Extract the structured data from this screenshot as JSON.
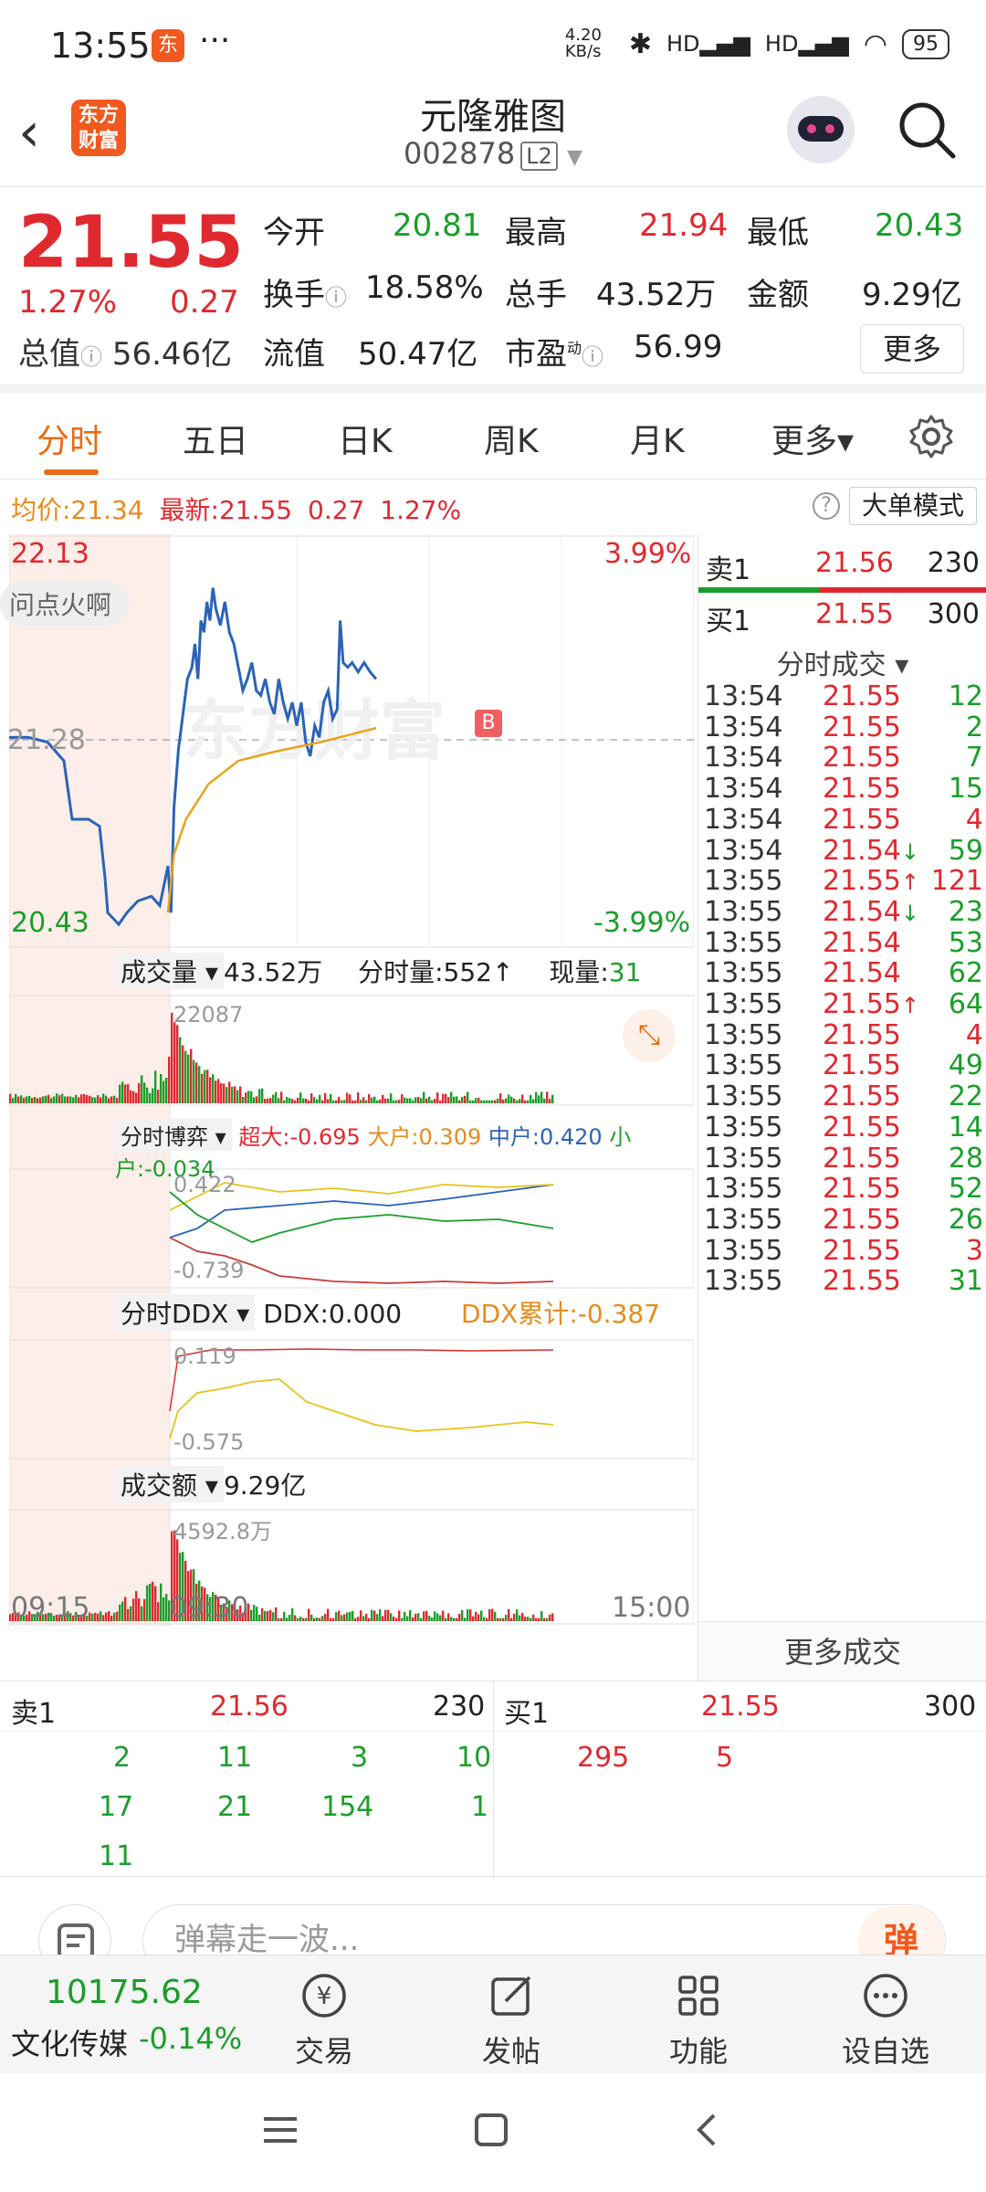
{
  "status_bar": {
    "time": "13:55",
    "app_icon": "东",
    "dots": "···",
    "net_speed": "4.20 KB/s",
    "signal1": "HD",
    "signal2": "HD",
    "battery": "95"
  },
  "header": {
    "back_icon": "chevron-left-icon",
    "logo_line1": "东方",
    "logo_line2": "财富",
    "stock_name": "元隆雅图",
    "stock_code": "002878",
    "level": "L2"
  },
  "quote": {
    "price": "21.55",
    "change_pct": "1.27%",
    "change": "0.27",
    "open_label": "今开",
    "open": "20.81",
    "high_label": "最高",
    "high": "21.94",
    "low_label": "最低",
    "low": "20.43",
    "turnover_label": "换手",
    "turnover": "18.58%",
    "volume_label": "总手",
    "volume": "43.52万",
    "amount_label": "金额",
    "amount": "9.29亿",
    "mktcap_label": "总值",
    "mktcap": "56.46亿",
    "float_label": "流值",
    "float": "50.47亿",
    "pe_label": "市盈",
    "pe_sup": "动",
    "pe": "56.99",
    "more": "更多"
  },
  "tabs": [
    {
      "label": "分时",
      "active": true
    },
    {
      "label": "五日"
    },
    {
      "label": "日K"
    },
    {
      "label": "周K"
    },
    {
      "label": "月K"
    },
    {
      "label": "更多▾"
    }
  ],
  "info_line": {
    "avg_label": "均价:",
    "avg": "21.34",
    "latest_label": "最新:",
    "latest": "21.55",
    "chg": "0.27",
    "pct": "1.27%",
    "help": "?",
    "big_order_mode": "大单模式"
  },
  "chart": {
    "high_price": "22.13",
    "low_price": "20.43",
    "ref_price": "21.28",
    "up_pct": "3.99%",
    "down_pct": "-3.99%",
    "overlay_text": "问点火啊",
    "marker": "B",
    "volume_panel": {
      "dropdown": "成交量",
      "total": "43.52万",
      "tick_label": "分时量:",
      "tick": "552",
      "tick_arrow": "↑",
      "now_label": "现量:",
      "now": "31",
      "max": "22087"
    },
    "game_panel": {
      "dropdown": "分时博弈",
      "super_label": "超大:",
      "super": "-0.695",
      "big_label": "大户:",
      "big": "0.309",
      "mid_label": "中户:",
      "mid": "0.420",
      "small_label": "小户:",
      "small": "-0.034",
      "top": "0.422",
      "bottom": "-0.739"
    },
    "ddx_panel": {
      "dropdown": "分时DDX",
      "ddx_label": "DDX:",
      "ddx": "0.000",
      "cum_label": "DDX累计:",
      "cum": "-0.387",
      "top": "0.119",
      "bottom": "-0.575"
    },
    "amount_panel": {
      "dropdown": "成交额",
      "total": "9.29亿",
      "max": "4592.8万"
    },
    "time_axis": [
      "09:15",
      "09:30",
      "15:00"
    ]
  },
  "order_book": {
    "sell1_label": "卖1",
    "sell1_price": "21.56",
    "sell1_vol": "230",
    "buy1_label": "买1",
    "buy1_price": "21.55",
    "buy1_vol": "300"
  },
  "trades_header": "分时成交 ▾",
  "trades": [
    {
      "time": "13:54",
      "price": "21.55",
      "arrow": "",
      "vol": "12",
      "dir": "g"
    },
    {
      "time": "13:54",
      "price": "21.55",
      "arrow": "",
      "vol": "2",
      "dir": "g"
    },
    {
      "time": "13:54",
      "price": "21.55",
      "arrow": "",
      "vol": "7",
      "dir": "g"
    },
    {
      "time": "13:54",
      "price": "21.55",
      "arrow": "",
      "vol": "15",
      "dir": "g"
    },
    {
      "time": "13:54",
      "price": "21.55",
      "arrow": "",
      "vol": "4",
      "dir": "r"
    },
    {
      "time": "13:54",
      "price": "21.54",
      "arrow": "↓",
      "vol": "59",
      "dir": "g"
    },
    {
      "time": "13:55",
      "price": "21.55",
      "arrow": "↑",
      "vol": "121",
      "dir": "r"
    },
    {
      "time": "13:55",
      "price": "21.54",
      "arrow": "↓",
      "vol": "23",
      "dir": "g"
    },
    {
      "time": "13:55",
      "price": "21.54",
      "arrow": "",
      "vol": "53",
      "dir": "g"
    },
    {
      "time": "13:55",
      "price": "21.54",
      "arrow": "",
      "vol": "62",
      "dir": "g"
    },
    {
      "time": "13:55",
      "price": "21.55",
      "arrow": "↑",
      "vol": "64",
      "dir": "g"
    },
    {
      "time": "13:55",
      "price": "21.55",
      "arrow": "",
      "vol": "4",
      "dir": "r"
    },
    {
      "time": "13:55",
      "price": "21.55",
      "arrow": "",
      "vol": "49",
      "dir": "g"
    },
    {
      "time": "13:55",
      "price": "21.55",
      "arrow": "",
      "vol": "22",
      "dir": "g"
    },
    {
      "time": "13:55",
      "price": "21.55",
      "arrow": "",
      "vol": "14",
      "dir": "g"
    },
    {
      "time": "13:55",
      "price": "21.55",
      "arrow": "",
      "vol": "28",
      "dir": "g"
    },
    {
      "time": "13:55",
      "price": "21.55",
      "arrow": "",
      "vol": "52",
      "dir": "g"
    },
    {
      "time": "13:55",
      "price": "21.55",
      "arrow": "",
      "vol": "26",
      "dir": "g"
    },
    {
      "time": "13:55",
      "price": "21.55",
      "arrow": "",
      "vol": "3",
      "dir": "r"
    },
    {
      "time": "13:55",
      "price": "21.55",
      "arrow": "",
      "vol": "31",
      "dir": "g"
    }
  ],
  "more_trades": "更多成交",
  "depth": {
    "sell_label": "卖1",
    "sell_price": "21.56",
    "sell_vol": "230",
    "buy_label": "买1",
    "buy_price": "21.55",
    "buy_vol": "300",
    "sell_queue": [
      "2",
      "11",
      "3",
      "10",
      "17",
      "21",
      "154",
      "1",
      "11"
    ],
    "buy_queue": [
      "295",
      "5"
    ]
  },
  "danmu": {
    "placeholder": "弹幕走一波...",
    "button": "弹"
  },
  "bottom_nav": {
    "index_value": "10175.62",
    "index_name": "文化传媒",
    "index_change": "-0.14%",
    "items": [
      {
        "label": "交易",
        "icon": "trade-icon"
      },
      {
        "label": "发帖",
        "icon": "post-icon"
      },
      {
        "label": "功能",
        "icon": "grid-icon"
      },
      {
        "label": "设自选",
        "icon": "more-icon"
      }
    ]
  },
  "colors": {
    "up": "#e0292f",
    "down": "#1a9e2a",
    "accent": "#e86b14",
    "avg_line": "#e8a31b",
    "price_line": "#2a63b9"
  }
}
